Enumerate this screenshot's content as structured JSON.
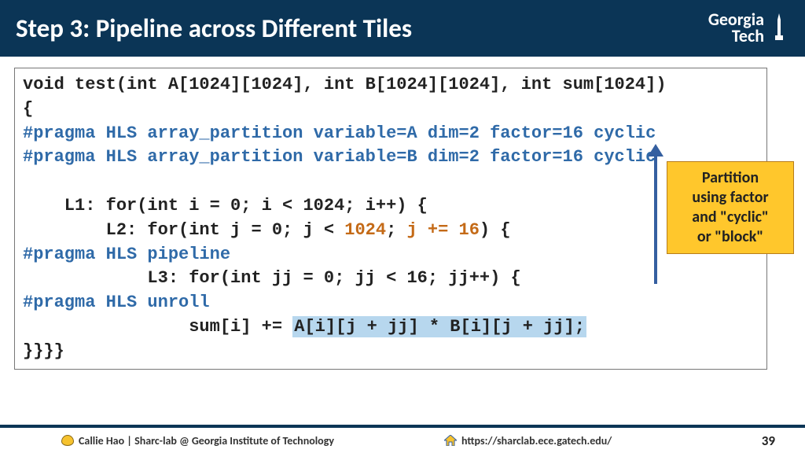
{
  "header": {
    "title": "Step 3: Pipeline across Different Tiles",
    "logo_line1": "Georgia",
    "logo_line2": "Tech"
  },
  "code": {
    "line1": "void test(int A[1024][1024], int B[1024][1024], int sum[1024])",
    "line1b": "{",
    "pragma1": "#pragma HLS array_partition variable=A dim=2 factor=16 cyclic",
    "pragma2": "#pragma HLS array_partition variable=B dim=2 factor=16 cyclic",
    "l1": "    L1: for(int i = 0; i < 1024; i++) {",
    "l2_pre": "        L2: for(int j = 0; j < ",
    "l2_1024": "1024",
    "l2_mid": "; ",
    "l2_step": "j += 16",
    "l2_end": ") {",
    "pragma3": "#pragma HLS pipeline",
    "l3": "            L3: for(int jj = 0; jj < 16; jj++) {",
    "pragma4": "#pragma HLS unroll",
    "sum_pre": "                sum[i] += ",
    "sum_hl": "A[i][j + jj] * B[i][j + jj];",
    "close": "}}}}"
  },
  "callout": {
    "l1": "Partition",
    "l2": "using factor",
    "l3": "and \"cyclic\"",
    "l4": "or \"block\""
  },
  "footer": {
    "left": "Callie Hao | Sharc-lab @ Georgia Institute of Technology",
    "center": "https://sharclab.ece.gatech.edu/",
    "page": "39"
  }
}
